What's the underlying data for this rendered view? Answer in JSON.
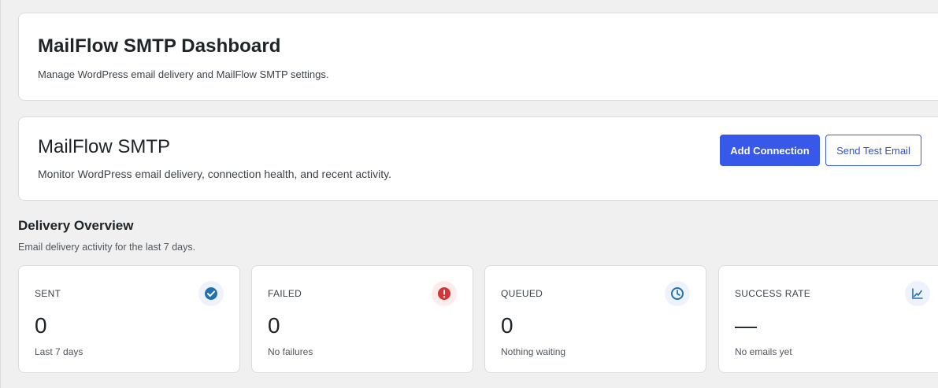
{
  "header": {
    "title": "MailFlow SMTP Dashboard",
    "subtitle": "Manage WordPress email delivery and MailFlow SMTP settings."
  },
  "plugin": {
    "title": "MailFlow SMTP",
    "subtitle": "Monitor WordPress email delivery, connection health, and recent activity.",
    "add_connection_label": "Add Connection",
    "send_test_label": "Send Test Email"
  },
  "overview": {
    "title": "Delivery Overview",
    "subtitle": "Email delivery activity for the last 7 days."
  },
  "stats": {
    "sent": {
      "label": "SENT",
      "value": "0",
      "desc": "Last 7 days",
      "icon": "check-circle-icon",
      "color": "#2271b1",
      "bg": "#eef3fb"
    },
    "failed": {
      "label": "FAILED",
      "value": "0",
      "desc": "No failures",
      "icon": "alert-circle-icon",
      "color": "#d63638",
      "bg": "#fcecec"
    },
    "queued": {
      "label": "QUEUED",
      "value": "0",
      "desc": "Nothing waiting",
      "icon": "clock-icon",
      "color": "#2271b1",
      "bg": "#eef3fb"
    },
    "rate": {
      "label": "SUCCESS RATE",
      "value": "—",
      "desc": "No emails yet",
      "icon": "trend-chart-icon",
      "color": "#2271b1",
      "bg": "#eef3fb"
    }
  },
  "colors": {
    "accent": "#3858e9",
    "background": "#f0f0f1",
    "card": "#ffffff",
    "border": "#dcdcde"
  }
}
